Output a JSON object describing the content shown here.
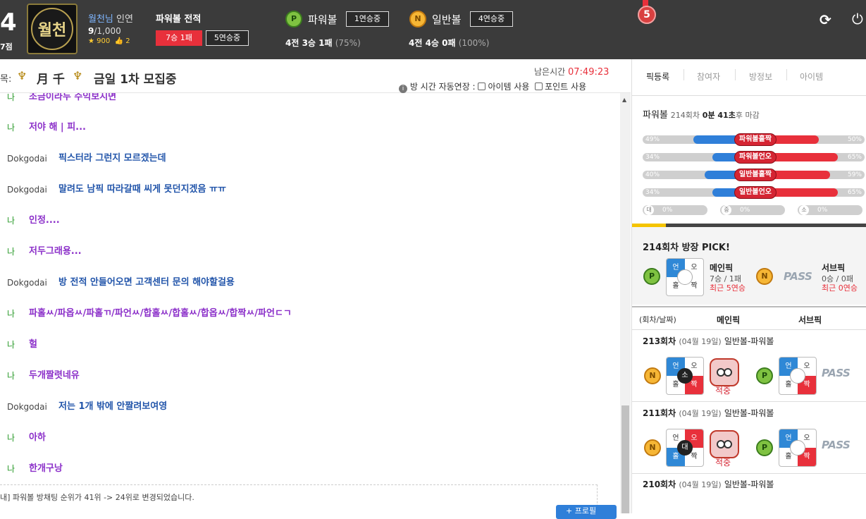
{
  "header": {
    "rank_num": "4",
    "rank_sub": "7점",
    "logo_text": "월천",
    "user_name": "월천님",
    "user_extra": "인연",
    "level": "9",
    "level_max": "/1,000",
    "stars": "900",
    "likes": "2",
    "record_title": "파워볼 전적",
    "record_wl": "7승 1패",
    "record_streak": "5연승중",
    "powerball_label": "파워볼",
    "powerball_streak": "1연승중",
    "powerball_stats": "4전 3승 1패",
    "powerball_pct": "(75%)",
    "normal_label": "일반볼",
    "normal_streak": "4연승중",
    "normal_stats": "4전 4승 0패",
    "normal_pct": "(100%)",
    "medal_num": "5",
    "p_letter": "P",
    "n_letter": "N",
    "refresh_icon": "⟳",
    "power_icon": "⏻"
  },
  "room": {
    "title_prefix": "목:",
    "title": "月 千",
    "title_suffix": "금일 1차 모집중",
    "remaining_label": "남은시간",
    "remaining_time": "07:49:23",
    "auto_extend_label": "방 시간 자동연장 :",
    "item_use": "아이템 사용",
    "point_use": "포인트 사용"
  },
  "chat": [
    {
      "nick": "나",
      "text": "조금이라두 수익보시면",
      "me": true
    },
    {
      "nick": "나",
      "text": "저야 해 | 피...",
      "me": true
    },
    {
      "nick": "Dokgodai",
      "text": "픽스터라 그런지 모르겠는데",
      "me": false
    },
    {
      "nick": "Dokgodai",
      "text": "말려도 남픽 따라갈때 씨게 못던지겠음 ㅠㅠ",
      "me": false
    },
    {
      "nick": "나",
      "text": "인정....",
      "me": true
    },
    {
      "nick": "나",
      "text": "저두그래용...",
      "me": true
    },
    {
      "nick": "Dokgodai",
      "text": "방 전적 안들어오면 고객센터 문의 해야할걸용",
      "me": false
    },
    {
      "nick": "나",
      "text": "파홀ㅆ/파옵ㅆ/파홀ㄲ/파언ㅆ/합홀ㅆ/합홀ㅆ/합옵ㅆ/합짝ㅆ/파언ㄷㄱ",
      "me": true
    },
    {
      "nick": "나",
      "text": "헐",
      "me": true
    },
    {
      "nick": "나",
      "text": "두개짤렷네유",
      "me": true
    },
    {
      "nick": "Dokgodai",
      "text": "저는 1개 밖에 안짤려보여영",
      "me": false
    },
    {
      "nick": "나",
      "text": "아하",
      "me": true
    },
    {
      "nick": "나",
      "text": "한개구낭",
      "me": true
    }
  ],
  "notice": "내] 파워볼 방채팅 순위가 41위 -> 24위로 변경되었습니다.",
  "profile_button": "프로필",
  "right": {
    "tabs": [
      "픽등록",
      "참여자",
      "방정보",
      "아이템"
    ],
    "round_label": "파워볼",
    "round_info": "214회차",
    "time_min": "0분",
    "time_sec": "41초",
    "time_suffix": "후 마감",
    "bars": [
      {
        "label": "파워볼홀짝",
        "left": "49%",
        "right": "50%",
        "left_frac": 0.49,
        "right_frac": 0.5
      },
      {
        "label": "파워볼언오",
        "left": "34%",
        "right": "65%",
        "left_frac": 0.34,
        "right_frac": 0.65
      },
      {
        "label": "일반볼홀짝",
        "left": "40%",
        "right": "59%",
        "left_frac": 0.4,
        "right_frac": 0.59
      },
      {
        "label": "일반볼언오",
        "left": "34%",
        "right": "65%",
        "left_frac": 0.34,
        "right_frac": 0.65
      }
    ],
    "size_bars": [
      {
        "icon": "대",
        "pct": "0%"
      },
      {
        "icon": "중",
        "pct": "0%"
      },
      {
        "icon": "소",
        "pct": "0%"
      }
    ],
    "pick_title": "214회차 방장 PICK!",
    "main_pick_label": "메인픽",
    "main_pick_record": "7승 / 1패",
    "main_pick_streak": "최근 5연승",
    "sub_pick_label": "서브픽",
    "sub_pick_record": "0승 / 0패",
    "sub_pick_streak": "최근 0연승",
    "pass_label": "PASS",
    "grid_labels": {
      "un": "언",
      "o": "오",
      "hol": "홀",
      "jjak": "짝"
    },
    "history_head": {
      "col1": "(회차/날짜)",
      "col2": "메인픽",
      "col3": "서브픽"
    },
    "history": [
      {
        "round": "213회차",
        "date": "(04월 19일)",
        "type": "일반볼-파워볼",
        "ctr": "소",
        "result": "적중"
      },
      {
        "round": "211회차",
        "date": "(04월 19일)",
        "type": "일반볼-파워볼",
        "ctr": "대",
        "result": "적중"
      },
      {
        "round": "210회차",
        "date": "(04월 19일)",
        "type": "일반볼-파워볼",
        "ctr": "",
        "result": ""
      }
    ]
  },
  "colors": {
    "accent_red": "#e8303b",
    "accent_blue": "#2f7fd9",
    "header_bg": "#3b3b3b",
    "chat_me": "#8b2fc9",
    "chat_other": "#2255aa"
  }
}
